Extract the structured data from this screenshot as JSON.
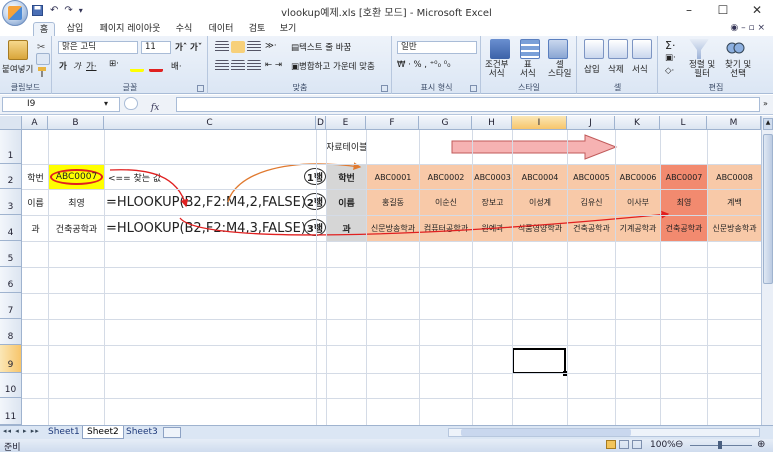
{
  "window": {
    "title": "vlookup예제.xls [호환 모드] - Microsoft Excel",
    "controls": {
      "minimize": "–",
      "maximize": "☐",
      "close": "✕"
    }
  },
  "ribbon_tabs": [
    "홈",
    "삽입",
    "페이지 레이아웃",
    "수식",
    "데이터",
    "검토",
    "보기"
  ],
  "ribbon": {
    "clipboard": {
      "paste": "붙여넣기",
      "label": "클립보드"
    },
    "font": {
      "name": "맑은 고딕",
      "size": "11",
      "label": "글꼴"
    },
    "alignment": {
      "wrap": "텍스트 줄 바꿈",
      "merge": "병합하고 가운데 맞춤",
      "label": "맞춤"
    },
    "number": {
      "format": "일반",
      "label": "표시 형식"
    },
    "styles": {
      "conditional": "조건부\n서식",
      "table": "표\n서식",
      "cell": "셀\n스타일",
      "label": "스타일"
    },
    "cells": {
      "insert": "삽입",
      "delete": "삭제",
      "format": "서식",
      "label": "셀"
    },
    "editing": {
      "sort": "정렬 및\n필터",
      "find": "찾기 및\n선택",
      "label": "편집"
    }
  },
  "formula_bar": {
    "name_box": "I9",
    "fx": "fx",
    "formula": ""
  },
  "columns": [
    "A",
    "B",
    "C",
    "D",
    "E",
    "F",
    "G",
    "H",
    "I",
    "J",
    "K",
    "L",
    "M"
  ],
  "rows": [
    "1",
    "2",
    "3",
    "4",
    "5",
    "6",
    "7",
    "8",
    "9",
    "10",
    "11"
  ],
  "cells": {
    "A2": "학번",
    "B2": "ABC0007",
    "C2": "<== 찾는 값",
    "A3": "이름",
    "B3": "최영",
    "C3": "=HLOOKUP(B2,F2:M4,2,FALSE)",
    "A4": "과",
    "B4": "건축공학과",
    "C4": "=HLOOKUP(B2,F2:M4,3,FALSE)",
    "E1": "자료테이블"
  },
  "row_markers": [
    "1행",
    "2행",
    "3행"
  ],
  "table": {
    "headers": [
      "학번",
      "이름",
      "과"
    ],
    "ids": [
      "ABC0001",
      "ABC0002",
      "ABC0003",
      "ABC0004",
      "ABC0005",
      "ABC0006",
      "ABC0007",
      "ABC0008"
    ],
    "names": [
      "홍길동",
      "이순신",
      "장보고",
      "이성계",
      "김유신",
      "이사부",
      "최영",
      "계백"
    ],
    "depts": [
      "신문방송학과",
      "컴퓨터공학과",
      "원예과",
      "식품영양학과",
      "건축공학과",
      "기계공학과",
      "건축공학과",
      "신문방송학과"
    ]
  },
  "sheets": [
    "Sheet1",
    "Sheet2",
    "Sheet3"
  ],
  "status": {
    "ready": "준비",
    "zoom": "100%"
  },
  "colors": {
    "highlight_yellow": "#ffff00",
    "table_fill": "#f8c9a8",
    "selected_col": "#f28a6f",
    "arrow_red": "#e02020",
    "arrow_orange": "#e07a30"
  }
}
